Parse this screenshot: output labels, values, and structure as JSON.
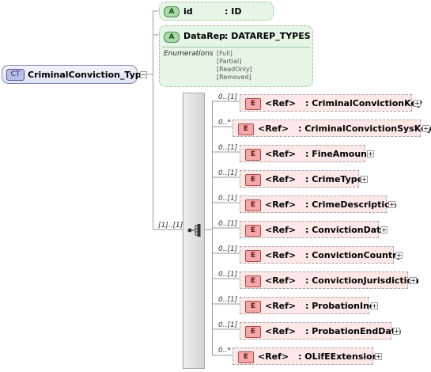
{
  "root": {
    "badge": "CT",
    "name": "CriminalConviction_Type"
  },
  "attributes": [
    {
      "badge": "A",
      "name": "id",
      "type": ": ID"
    },
    {
      "badge": "A",
      "name": "DataRep",
      "type": ": DATAREP_TYPES",
      "enumerations_label": "Enumerations",
      "enumerations": [
        "[Full]",
        "[Partial]",
        "[ReadOnly]",
        "[Removed]"
      ]
    }
  ],
  "sequence": {
    "multiplicity": "[1]..[1]",
    "icon": "sequence-compositor-icon"
  },
  "elements": [
    {
      "badge": "E",
      "ref": "<Ref>",
      "name": ": CriminalConvictionKey",
      "multiplicity": "0..[1]"
    },
    {
      "badge": "E",
      "ref": "<Ref>",
      "name": ": CriminalConvictionSysKey",
      "multiplicity": "0..*"
    },
    {
      "badge": "E",
      "ref": "<Ref>",
      "name": ": FineAmount",
      "multiplicity": "0..[1]"
    },
    {
      "badge": "E",
      "ref": "<Ref>",
      "name": ": CrimeType",
      "multiplicity": "0..[1]"
    },
    {
      "badge": "E",
      "ref": "<Ref>",
      "name": ": CrimeDescription",
      "multiplicity": "0..[1]"
    },
    {
      "badge": "E",
      "ref": "<Ref>",
      "name": ": ConvictionDate",
      "multiplicity": "0..[1]"
    },
    {
      "badge": "E",
      "ref": "<Ref>",
      "name": ": ConvictionCountry",
      "multiplicity": "0..[1]"
    },
    {
      "badge": "E",
      "ref": "<Ref>",
      "name": ": ConvictionJurisdiction",
      "multiplicity": "0..[1]"
    },
    {
      "badge": "E",
      "ref": "<Ref>",
      "name": ": ProbationInd",
      "multiplicity": "0..[1]"
    },
    {
      "badge": "E",
      "ref": "<Ref>",
      "name": ": ProbationEndDate",
      "multiplicity": "0..[1]"
    },
    {
      "badge": "E",
      "ref": "<Ref>",
      "name": ": OLifEExtension",
      "multiplicity": "0..*"
    }
  ]
}
